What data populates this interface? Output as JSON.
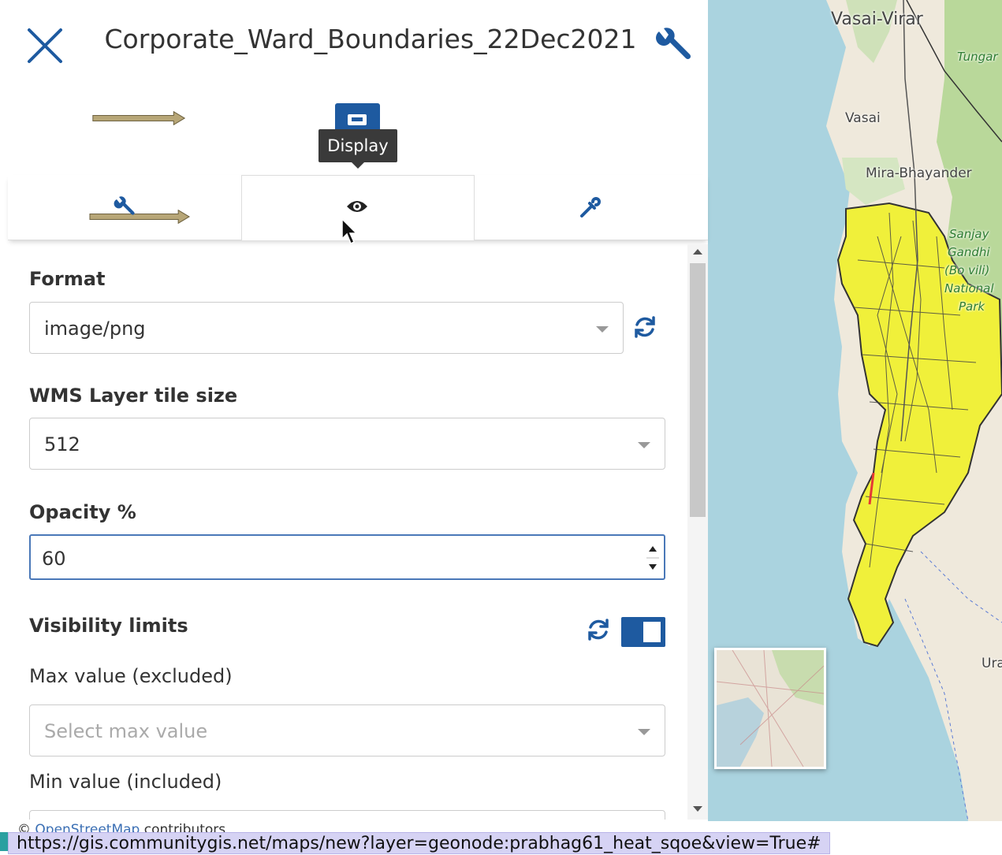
{
  "header": {
    "title": "Corporate_Ward_Boundaries_22Dec2021"
  },
  "tooltip": {
    "text": "Display"
  },
  "tabs": [
    {
      "icon": "wrench-icon"
    },
    {
      "icon": "eye-icon",
      "active": true
    },
    {
      "icon": "eyedropper-icon"
    }
  ],
  "form": {
    "format": {
      "label": "Format",
      "value": "image/png"
    },
    "tile_size": {
      "label": "WMS Layer tile size",
      "value": "512"
    },
    "opacity": {
      "label": "Opacity %",
      "value": "60"
    },
    "visibility": {
      "label": "Visibility limits",
      "max_label": "Max value (excluded)",
      "max_placeholder": "Select max value",
      "min_label": "Min value (included)"
    }
  },
  "map": {
    "labels": {
      "vasai_virar": "Vasai-Virar",
      "vasai": "Vasai",
      "mira": "Mira-Bhayander",
      "tungar": "Tungar",
      "park1": "Sanjay",
      "park2": "Gandhi",
      "park3": "(Bo  vili)",
      "park4": "National",
      "park5": "Park",
      "ura": "Ura"
    },
    "attribution_prefix": "©",
    "attribution_link": "OpenStreetMap",
    "attribution_suffix": "contributors"
  },
  "status_url": "https://gis.communitygis.net/maps/new?layer=geonode:prabhag61_heat_sqoe&view=True#",
  "colors": {
    "accent": "#1e5aa0",
    "ward_fill": "#f0f03a",
    "water": "#aad3df"
  }
}
